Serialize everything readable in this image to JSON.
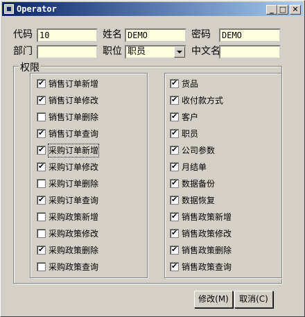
{
  "window": {
    "title": "Operator",
    "minimize": "_",
    "maximize": "□",
    "close": "✕"
  },
  "form": {
    "code_label": "代码",
    "code_value": "10",
    "name_label": "姓名",
    "name_value": "DEMO",
    "password_label": "密码",
    "password_value": "DEMO",
    "dept_label": "部门",
    "dept_value": "",
    "position_label": "职位",
    "position_value": "职员",
    "cnname_label": "中文名",
    "cnname_value": ""
  },
  "permissions": {
    "group_label": "权限",
    "left": [
      {
        "label": "销售订单新增",
        "checked": true
      },
      {
        "label": "销售订单修改",
        "checked": true
      },
      {
        "label": "销售订单删除",
        "checked": false
      },
      {
        "label": "销售订单查询",
        "checked": true
      },
      {
        "label": "采购订单新增",
        "checked": true
      },
      {
        "label": "采购订单修改",
        "checked": true
      },
      {
        "label": "采购订单删除",
        "checked": false
      },
      {
        "label": "采购订单查询",
        "checked": true
      },
      {
        "label": "采购政策新增",
        "checked": false
      },
      {
        "label": "采购政策修改",
        "checked": false
      },
      {
        "label": "采购政策删除",
        "checked": true
      },
      {
        "label": "采购政策查询",
        "checked": false
      }
    ],
    "right": [
      {
        "label": "货品",
        "checked": true
      },
      {
        "label": "收付款方式",
        "checked": true
      },
      {
        "label": "客户",
        "checked": true
      },
      {
        "label": "职员",
        "checked": true
      },
      {
        "label": "公司参数",
        "checked": true
      },
      {
        "label": "月结单",
        "checked": true
      },
      {
        "label": "数据备份",
        "checked": true
      },
      {
        "label": "数据恢复",
        "checked": true
      },
      {
        "label": "销售政策新增",
        "checked": true
      },
      {
        "label": "销售政策修改",
        "checked": true
      },
      {
        "label": "销售政策删除",
        "checked": true
      },
      {
        "label": "销售政策查询",
        "checked": true
      }
    ]
  },
  "buttons": {
    "modify": "修改(M)",
    "cancel": "取消(C)"
  }
}
